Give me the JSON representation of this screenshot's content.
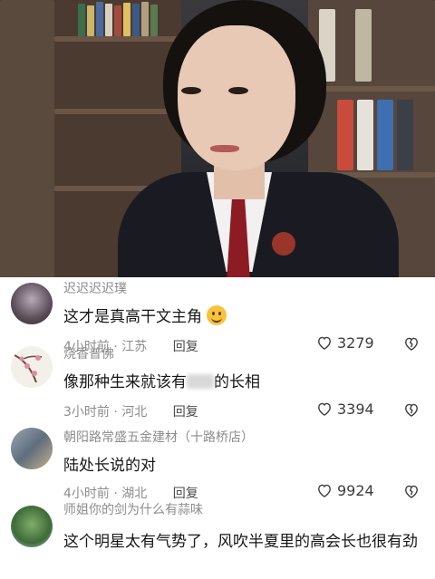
{
  "video": {
    "watermark_text": ""
  },
  "comments": [
    {
      "username": "迟迟迟迟璞",
      "text": "这才是真高干文主角",
      "emoji": "smile-emoji",
      "time": "4小时前",
      "location": "江苏",
      "reply_label": "回复",
      "likes": "3279"
    },
    {
      "username": "烧香普佛",
      "text_part1": "像那种生来就该有",
      "text_part2": "的长相",
      "time": "3小时前",
      "location": "河北",
      "reply_label": "回复",
      "likes": "3394"
    },
    {
      "username": "朝阳路常盛五金建材（十路桥店）",
      "text": "陆处长说的对",
      "time": "4小时前",
      "location": "湖北",
      "reply_label": "回复",
      "likes": "9924"
    },
    {
      "username": "师姐你的剑为什么有蒜味",
      "text": "这个明星太有气势了，风吹半夏里的高会长也很有劲"
    }
  ],
  "colors": {
    "meta_gray": "#8c8c8c",
    "text_dark": "#161616"
  },
  "icons": {
    "like": "heart-outline-icon",
    "dislike": "broken-heart-outline-icon"
  }
}
